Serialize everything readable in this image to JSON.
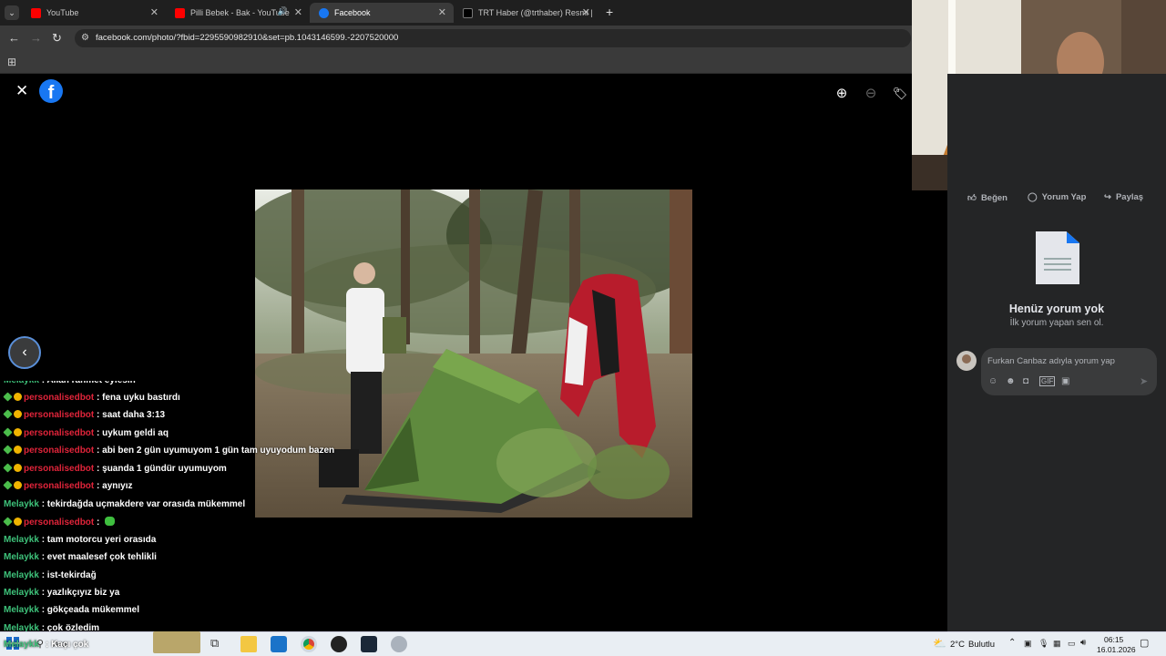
{
  "tabs": [
    {
      "title": "YouTube",
      "color": "#ff0000"
    },
    {
      "title": "Pilli Bebek - Bak - YouTube",
      "color": "#ff0000"
    },
    {
      "title": "Facebook",
      "color": "#1877f2"
    },
    {
      "title": "TRT Haber (@trthaber) Resmi |",
      "color": "#ffffff"
    }
  ],
  "browser": {
    "url": "facebook.com/photo/?fbid=2295590982910&set=pb.1043146599.-2207520000",
    "new_tab": "+"
  },
  "viewer": {
    "close_icon": "close-icon",
    "logo": "facebook-logo",
    "zoom_in_icon": "zoom-in-icon",
    "zoom_out_icon": "zoom-out-icon",
    "tag_icon": "tag-icon",
    "prev_icon": "chevron-left-icon"
  },
  "side": {
    "like": "Beğen",
    "comment": "Yorum Yap",
    "share": "Paylaş",
    "empty_title": "Henüz yorum yok",
    "empty_sub": "İlk yorum yapan sen ol.",
    "comment_placeholder": "Furkan Canbaz adıyla yorum yap"
  },
  "chat": [
    {
      "user": "Melaykk",
      "text": ": Allah rahmet eylesin",
      "type": "mel",
      "badge": false
    },
    {
      "user": "personalisedbot",
      "text": ": fena uyku bastırdı",
      "type": "bot",
      "badge": true
    },
    {
      "user": "personalisedbot",
      "text": ": saat daha 3:13",
      "type": "bot",
      "badge": true
    },
    {
      "user": "personalisedbot",
      "text": ": uykum geldi aq",
      "type": "bot",
      "badge": true
    },
    {
      "user": "personalisedbot",
      "text": ": abi ben 2 gün uyumuyom 1 gün tam uyuyodum bazen",
      "type": "bot",
      "badge": true
    },
    {
      "user": "personalisedbot",
      "text": ": şuanda 1 gündür uyumuyom",
      "type": "bot",
      "badge": true
    },
    {
      "user": "personalisedbot",
      "text": ": aynıyız",
      "type": "bot",
      "badge": true
    },
    {
      "user": "Melaykk",
      "text": ": tekirdağda uçmakdere var orasıda mükemmel",
      "type": "mel",
      "badge": false
    },
    {
      "user": "personalisedbot",
      "text": ":",
      "type": "bot",
      "badge": true
    },
    {
      "user": "Melaykk",
      "text": ": tam motorcu yeri orasıda",
      "type": "mel",
      "badge": false
    },
    {
      "user": "Melaykk",
      "text": ": evet maalesef çok tehlikli",
      "type": "mel",
      "badge": false
    },
    {
      "user": "Melaykk",
      "text": ": ist-tekirdağ",
      "type": "mel",
      "badge": false
    },
    {
      "user": "Melaykk",
      "text": ": yazlıkçıyız biz ya",
      "type": "mel",
      "badge": false
    },
    {
      "user": "Melaykk",
      "text": ": gökçeada mükemmel",
      "type": "mel",
      "badge": false
    },
    {
      "user": "Melaykk",
      "text": ": çok özledim",
      "type": "mel",
      "badge": false
    }
  ],
  "taskbar": {
    "search": "Ara",
    "search_overlay_user": "Melaykk",
    "search_overlay_text": ": Kaçı çok",
    "weather": "2°C",
    "weather_text": "Bulutlu",
    "time": "06:15",
    "date": "16.01.2026"
  }
}
